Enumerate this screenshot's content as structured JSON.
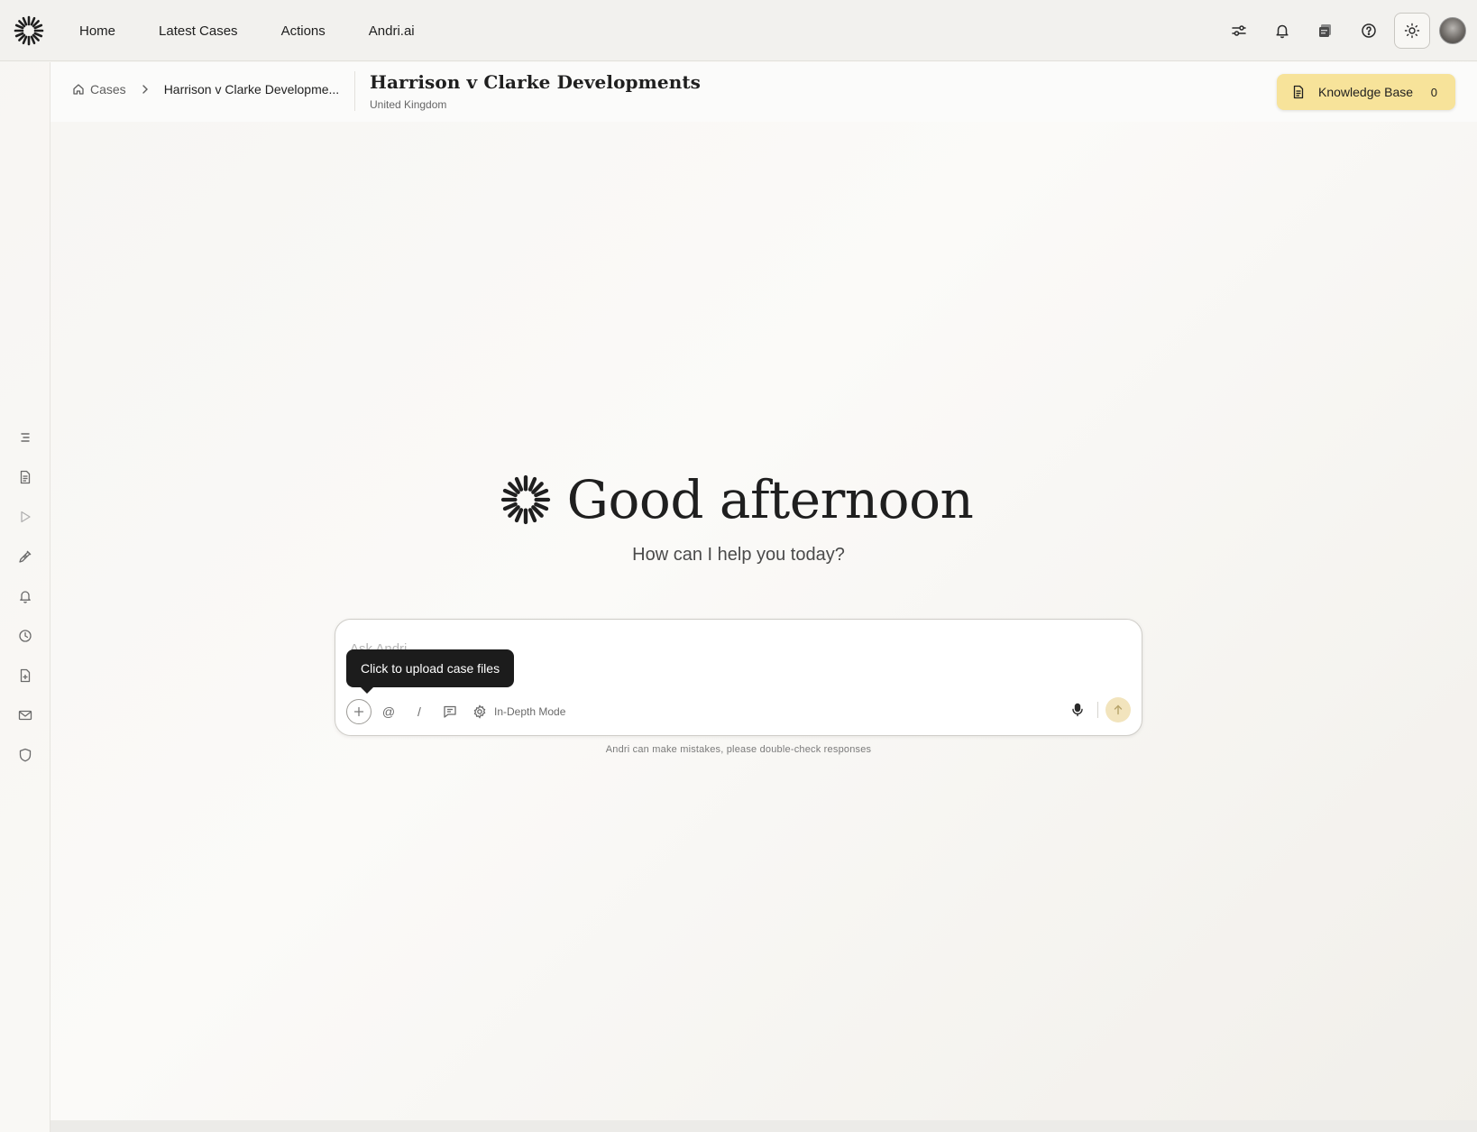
{
  "nav": {
    "items": [
      {
        "label": "Home"
      },
      {
        "label": "Latest Cases"
      },
      {
        "label": "Actions"
      },
      {
        "label": "Andri.ai"
      }
    ]
  },
  "top_icons": [
    "sliders-icon",
    "bell-icon",
    "inbox-stack-icon",
    "help-circle-icon",
    "sun-icon"
  ],
  "breadcrumb": {
    "home_label": "Cases",
    "current": "Harrison v Clarke Developme..."
  },
  "case": {
    "title": "Harrison v Clarke Developments",
    "jurisdiction": "United Kingdom"
  },
  "knowledge_base": {
    "label": "Knowledge Base",
    "count": "0"
  },
  "rail_icons": [
    "list-icon",
    "document-icon",
    "play-icon",
    "pen-nib-icon",
    "bell-icon",
    "clock-icon",
    "file-plus-icon",
    "mail-icon",
    "shield-icon"
  ],
  "greeting": {
    "title": "Good afternoon",
    "subtitle": "How can I help you today?"
  },
  "chat": {
    "placeholder": "Ask Andri...",
    "mention_symbol": "@",
    "slash_symbol": "/",
    "mode_label": "In-Depth Mode",
    "tooltip": "Click to upload case files",
    "disclaimer": "Andri can make mistakes, please double-check responses"
  },
  "colors": {
    "accent": "#f7e39a",
    "send_button": "#f2e4bd",
    "tooltip_bg": "#1c1c1c"
  }
}
